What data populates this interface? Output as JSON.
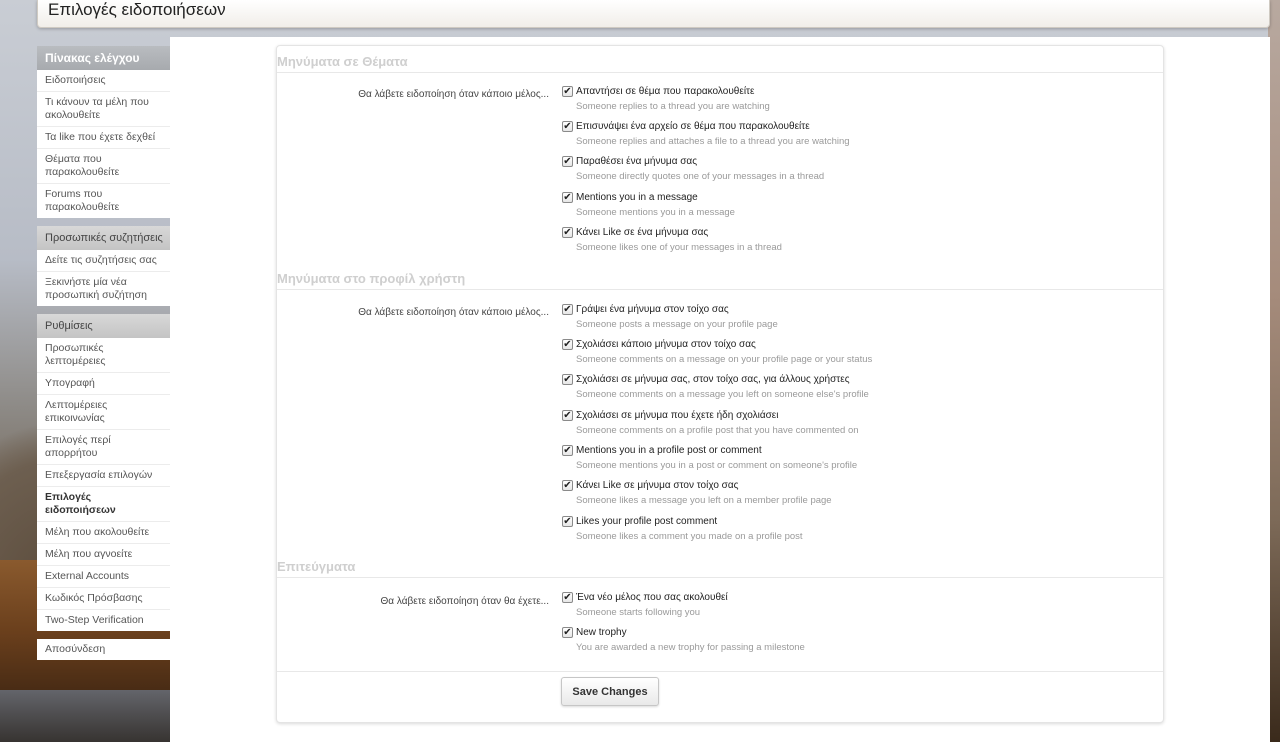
{
  "page": {
    "title": "Επιλογές ειδοποιήσεων"
  },
  "sidebar": {
    "blocks": [
      {
        "heading": "Πίνακας ελέγχου",
        "items": [
          "Ειδοποιήσεις",
          "Τι κάνουν τα μέλη που ακολουθείτε",
          "Τα like που έχετε δεχθεί",
          "Θέματα που παρακολουθείτε",
          "Forums που παρακολουθείτε"
        ]
      },
      {
        "heading": "Προσωπικές συζητήσεις",
        "items": [
          "Δείτε τις συζητήσεις σας",
          "Ξεκινήστε μία νέα προσωπική συζήτηση"
        ]
      },
      {
        "heading": "Ρυθμίσεις",
        "items": [
          "Προσωπικές λεπτομέρειες",
          "Υπογραφή",
          "Λεπτομέρειες επικοινωνίας",
          "Επιλογές περί απορρήτου",
          "Επεξεργασία επιλογών",
          "Επιλογές ειδοποιήσεων",
          "Μέλη που ακολουθείτε",
          "Μέλη που αγνοείτε",
          "External Accounts",
          "Κωδικός Πρόσβασης",
          "Two-Step Verification"
        ],
        "active": "Επιλογές ειδοποιήσεων"
      }
    ],
    "logout": "Αποσύνδεση"
  },
  "sections": [
    {
      "title": "Μηνύματα σε Θέματα",
      "label": "Θα λάβετε ειδοποίηση όταν κάποιο μέλος...",
      "options": [
        {
          "label": "Απαντήσει σε θέμα που παρακολουθείτε",
          "hint": "Someone replies to a thread you are watching",
          "checked": true
        },
        {
          "label": "Επισυνάψει ένα αρχείο σε θέμα που παρακολουθείτε",
          "hint": "Someone replies and attaches a file to a thread you are watching",
          "checked": true
        },
        {
          "label": "Παραθέσει ένα μήνυμα σας",
          "hint": "Someone directly quotes one of your messages in a thread",
          "checked": true
        },
        {
          "label": "Mentions you in a message",
          "hint": "Someone mentions you in a message",
          "checked": true
        },
        {
          "label": "Κάνει Like σε ένα μήνυμα σας",
          "hint": "Someone likes one of your messages in a thread",
          "checked": true
        }
      ]
    },
    {
      "title": "Μηνύματα στο προφίλ χρήστη",
      "label": "Θα λάβετε ειδοποίηση όταν κάποιο μέλος...",
      "options": [
        {
          "label": "Γράψει ένα μήνυμα στον τοίχο σας",
          "hint": "Someone posts a message on your profile page",
          "checked": true
        },
        {
          "label": "Σχολιάσει κάποιο μήνυμα στον τοίχο σας",
          "hint": "Someone comments on a message on your profile page or your status",
          "checked": true
        },
        {
          "label": "Σχολιάσει σε μήνυμα σας, στον τοίχο σας, για άλλους χρήστες",
          "hint": "Someone comments on a message you left on someone else's profile",
          "checked": true
        },
        {
          "label": "Σχολιάσει σε μήνυμα που έχετε ήδη σχολιάσει",
          "hint": "Someone comments on a profile post that you have commented on",
          "checked": true
        },
        {
          "label": "Mentions you in a profile post or comment",
          "hint": "Someone mentions you in a post or comment on someone's profile",
          "checked": true
        },
        {
          "label": "Κάνει Like σε μήνυμα στον τοίχο σας",
          "hint": "Someone likes a message you left on a member profile page",
          "checked": true
        },
        {
          "label": "Likes your profile post comment",
          "hint": "Someone likes a comment you made on a profile post",
          "checked": true
        }
      ]
    },
    {
      "title": "Επιτεύγματα",
      "label": "Θα λάβετε ειδοποίηση όταν θα έχετε...",
      "options": [
        {
          "label": "Ένα νέο μέλος που σας ακολουθεί",
          "hint": "Someone starts following you",
          "checked": true
        },
        {
          "label": "New trophy",
          "hint": "You are awarded a new trophy for passing a milestone",
          "checked": true
        }
      ]
    }
  ],
  "form": {
    "save_label": "Save Changes"
  }
}
